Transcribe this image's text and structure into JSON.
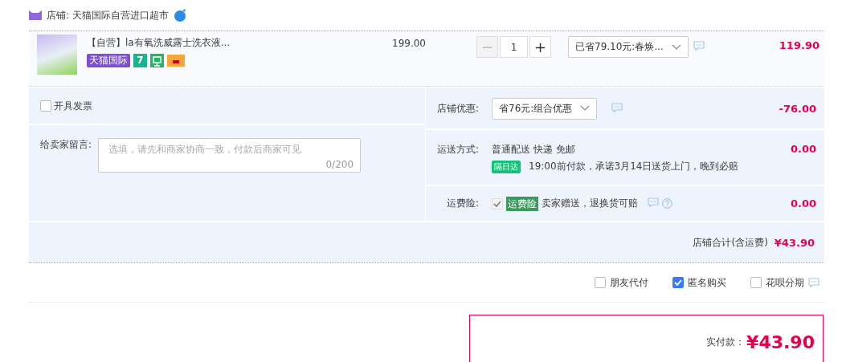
{
  "store": {
    "label": "店铺: 天猫国际自营进口超市"
  },
  "item": {
    "title": "【自营】la有氧洗威露士洗衣液...",
    "tag": "天猫国际",
    "badge_text": "7",
    "unit_price": "199.00",
    "minus": "−",
    "quantity": "1",
    "plus": "+",
    "promo": "已省79.10元:春焕...",
    "subtotal": "119.90"
  },
  "invoice": {
    "label": "开具发票",
    "checked": false
  },
  "message": {
    "label": "给卖家留言:",
    "placeholder": "选填，请先和商家协商一致，付款后商家可见",
    "counter": "0/200"
  },
  "discount": {
    "label": "店铺优惠:",
    "value": "省76元:组合优惠",
    "amount": "-76.00"
  },
  "shipping": {
    "label": "运送方式:",
    "method": "普通配送 快递 免邮",
    "badge": "隔日达",
    "note": "19:00前付款，承诺3月14日送货上门，晚到必赔",
    "amount": "0.00"
  },
  "insurance": {
    "label": "运费险:",
    "checked": true,
    "disabled": true,
    "tag": "运费险",
    "note": "卖家赠送，退换货可赔",
    "amount": "0.00"
  },
  "store_total": {
    "label": "店铺合计(含运费)",
    "amount": "¥43.90"
  },
  "options": [
    {
      "label": "朋友代付",
      "checked": false
    },
    {
      "label": "匿名购买",
      "checked": true
    },
    {
      "label": "花呗分期",
      "checked": false
    }
  ],
  "payment": {
    "label": "实付款：",
    "amount": "¥43.90"
  }
}
